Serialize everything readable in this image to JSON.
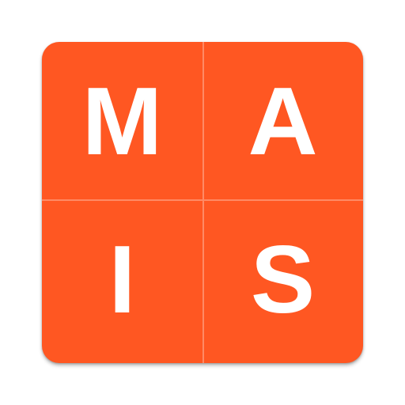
{
  "logo": {
    "letters": [
      "M",
      "A",
      "I",
      "S"
    ],
    "background_color": "#ff5722",
    "divider_color": "#ff8a65",
    "letter_color": "#ffffff"
  }
}
